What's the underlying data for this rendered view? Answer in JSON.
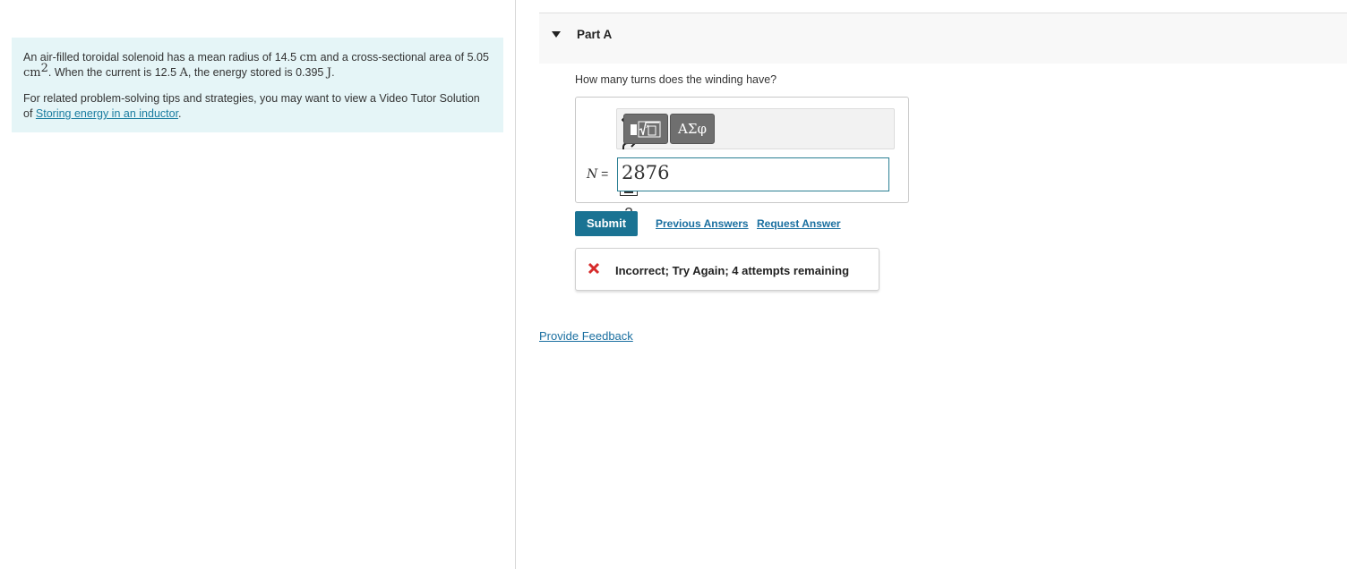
{
  "problem": {
    "sentence1_pre": "An air-filled toroidal solenoid has a mean radius of 14.5 ",
    "unit_cm": "cm",
    "sentence1_mid": " and a cross-sectional area of 5.05 ",
    "unit_cm2": "cm",
    "unit_cm2_exp": "2",
    "sentence1_post": ". When the current is 12.5 ",
    "unit_A": "A",
    "sentence1_end": ", the energy stored is 0.395 ",
    "unit_J": "J",
    "period": ".",
    "tips_pre": "For related problem-solving tips and strategies, you may want to view a Video Tutor Solution of ",
    "tips_link": "Storing energy in an inductor",
    "tips_post": "."
  },
  "part": {
    "title": "Part A"
  },
  "question": "How many turns does the winding have?",
  "toolbar": {
    "greek_label": "ΑΣφ",
    "help_label": "?"
  },
  "answer": {
    "variable": "N",
    "equals": " =",
    "value": "2876"
  },
  "actions": {
    "submit": "Submit",
    "previous_answers": "Previous Answers",
    "request_answer": "Request Answer"
  },
  "feedback": {
    "message": "Incorrect; Try Again; 4 attempts remaining"
  },
  "footer": {
    "provide_feedback": "Provide Feedback"
  },
  "colors": {
    "problem_bg": "#e5f5f7",
    "submit_bg": "#1a7393",
    "link": "#1a6fa0",
    "error": "#d62b2b"
  }
}
